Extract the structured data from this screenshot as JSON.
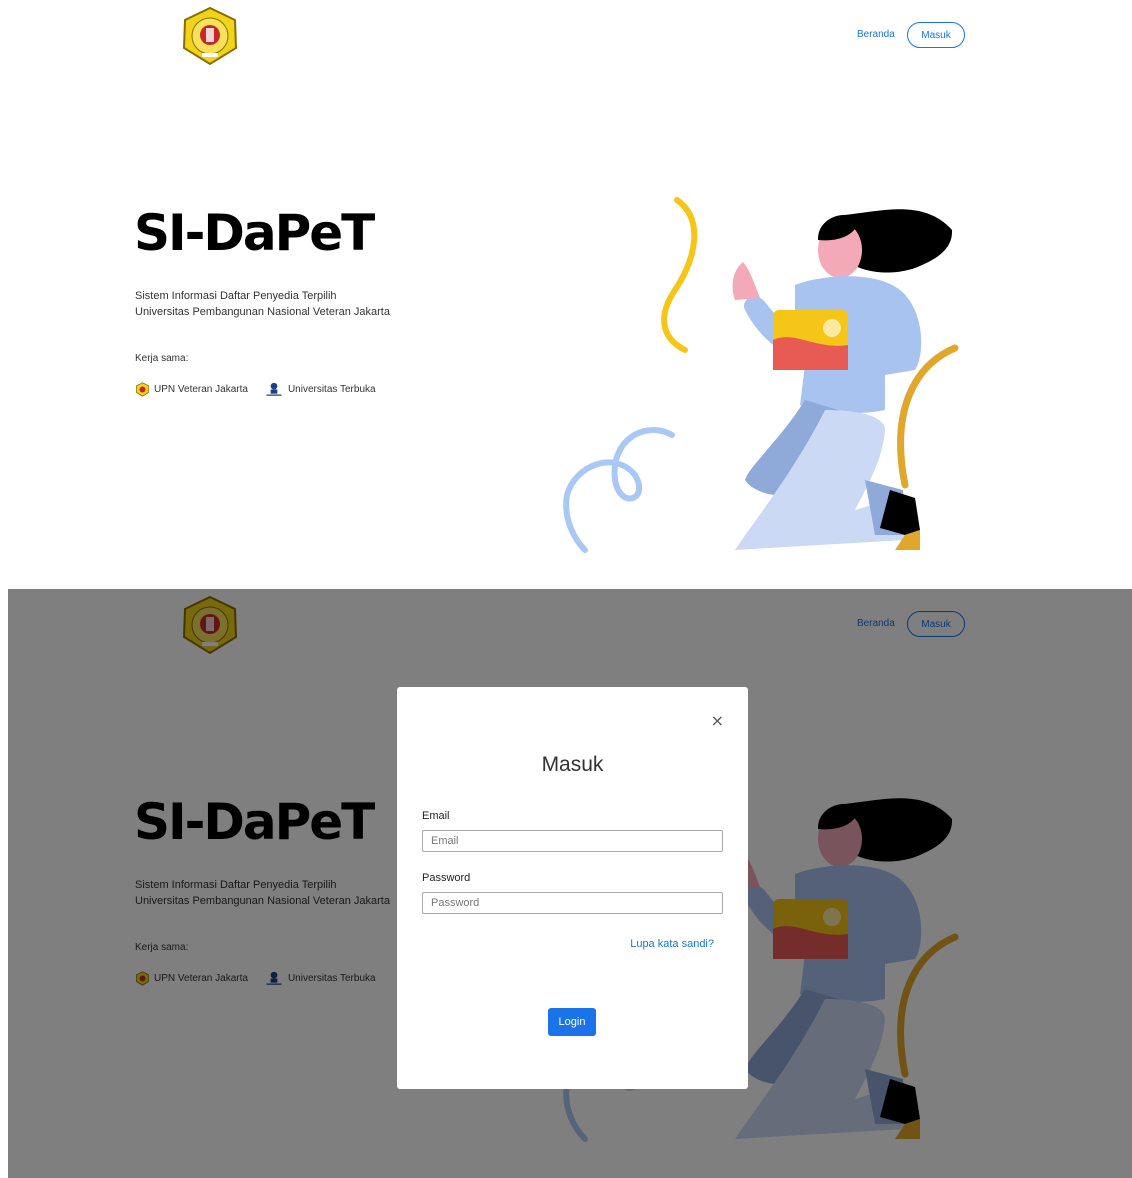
{
  "nav": {
    "beranda": "Beranda",
    "masuk": "Masuk"
  },
  "hero": {
    "title": "SI-DaPeT",
    "subtitle_line1": "Sistem Informasi Daftar Penyedia Terpilih",
    "subtitle_line2": "Universitas Pembangunan Nasional Veteran Jakarta",
    "kerja_sama": "Kerja sama:",
    "partners": [
      {
        "name": "UPN Veteran Jakarta",
        "icon": "upn-logo-icon"
      },
      {
        "name": "Universitas Terbuka",
        "icon": "ut-logo-icon"
      }
    ]
  },
  "modal": {
    "close": "×",
    "title": "Masuk",
    "email_label": "Email",
    "email_placeholder": "Email",
    "password_label": "Password",
    "password_placeholder": "Password",
    "forgot": "Lupa kata sandi?",
    "login": "Login"
  },
  "colors": {
    "accent": "#1a73e8",
    "overlay": "rgba(0,0,0,0.5)"
  }
}
